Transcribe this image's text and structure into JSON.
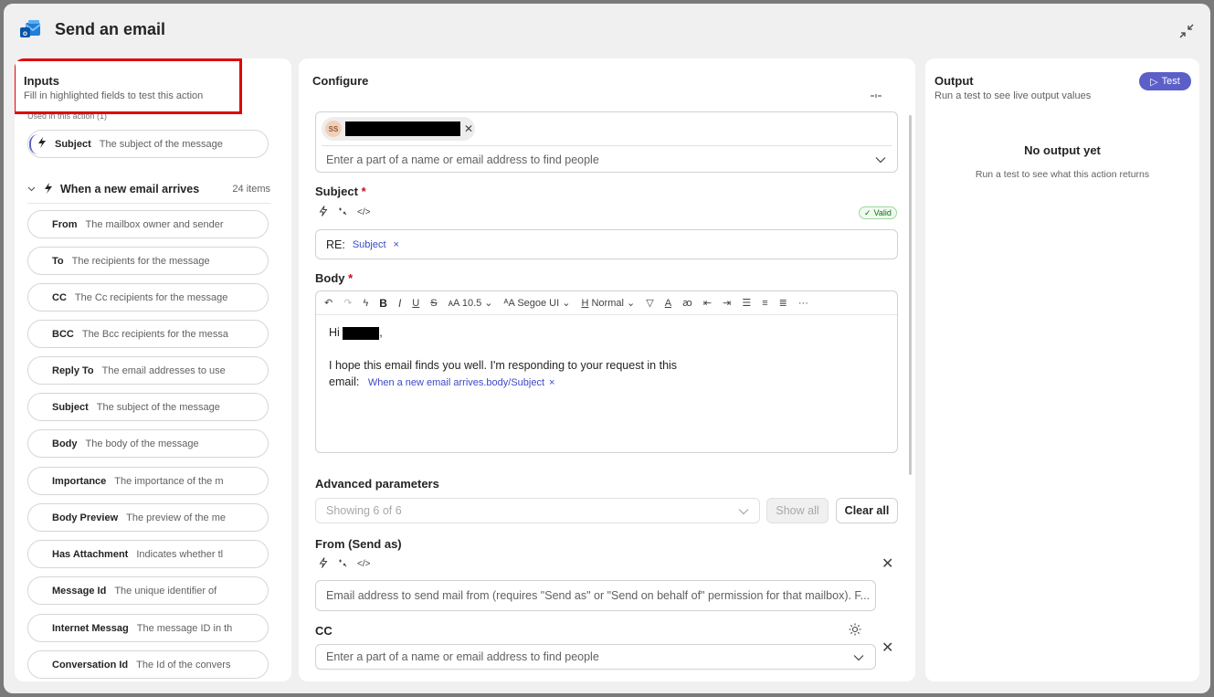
{
  "window": {
    "title": "Send an email",
    "collapse_icon": "collapse-arrows-icon"
  },
  "inputs": {
    "heading": "Inputs",
    "subtitle": "Fill in highlighted fields to test this action",
    "used_label": "Used in this action (1)",
    "used_item": {
      "key": "Subject",
      "desc": "The subject of the message"
    },
    "group": {
      "label": "When a new email arrives",
      "count": "24 items"
    },
    "items": [
      {
        "key": "From",
        "desc": "The mailbox owner and sender"
      },
      {
        "key": "To",
        "desc": "The recipients for the message"
      },
      {
        "key": "CC",
        "desc": "The Cc recipients for the message"
      },
      {
        "key": "BCC",
        "desc": "The Bcc recipients for the messa"
      },
      {
        "key": "Reply To",
        "desc": "The email addresses to use"
      },
      {
        "key": "Subject",
        "desc": "The subject of the message"
      },
      {
        "key": "Body",
        "desc": "The body of the message"
      },
      {
        "key": "Importance",
        "desc": "The importance of the m"
      },
      {
        "key": "Body Preview",
        "desc": "The preview of the me"
      },
      {
        "key": "Has Attachment",
        "desc": "Indicates whether tl"
      },
      {
        "key": "Message Id",
        "desc": "The unique identifier of"
      },
      {
        "key": "Internet Messag",
        "desc": "The message ID in th"
      },
      {
        "key": "Conversation Id",
        "desc": "The Id of the convers"
      }
    ]
  },
  "configure": {
    "heading": "Configure",
    "to": {
      "avatar_initials": "SS",
      "placeholder": "Enter a part of a name or email address to find people"
    },
    "subject": {
      "label": "Subject",
      "required": "*",
      "valid_badge": "Valid",
      "prefix": "RE:",
      "token": "Subject",
      "token_remove": "×"
    },
    "body": {
      "label": "Body",
      "required": "*",
      "toolbar": {
        "font_size": "10.5",
        "font_name": "Segoe UI",
        "style": "Normal",
        "more": "···"
      },
      "greeting": "Hi",
      "greeting_end": ",",
      "line1": "I hope this email finds you well. I'm responding to your request in this",
      "line2_prefix": "email:",
      "token": "When a new email arrives.body/Subject",
      "token_remove": "×"
    },
    "advanced": {
      "label": "Advanced parameters",
      "select_value": "Showing 6 of 6",
      "show_all": "Show all",
      "clear_all": "Clear all"
    },
    "from": {
      "label": "From (Send as)",
      "placeholder": "Email address to send mail from (requires \"Send as\" or \"Send on behalf of\" permission for that mailbox). F..."
    },
    "cc": {
      "label": "CC",
      "placeholder": "Enter a part of a name or email address to find people"
    }
  },
  "output": {
    "heading": "Output",
    "subtitle": "Run a test to see live output values",
    "test_button": "Test",
    "empty_title": "No output yet",
    "empty_sub": "Run a test to see what this action returns"
  },
  "colors": {
    "accent": "#5b5fc7",
    "token": "#3b49c8",
    "highlight": "#e0000a",
    "valid": "#0e700e"
  }
}
